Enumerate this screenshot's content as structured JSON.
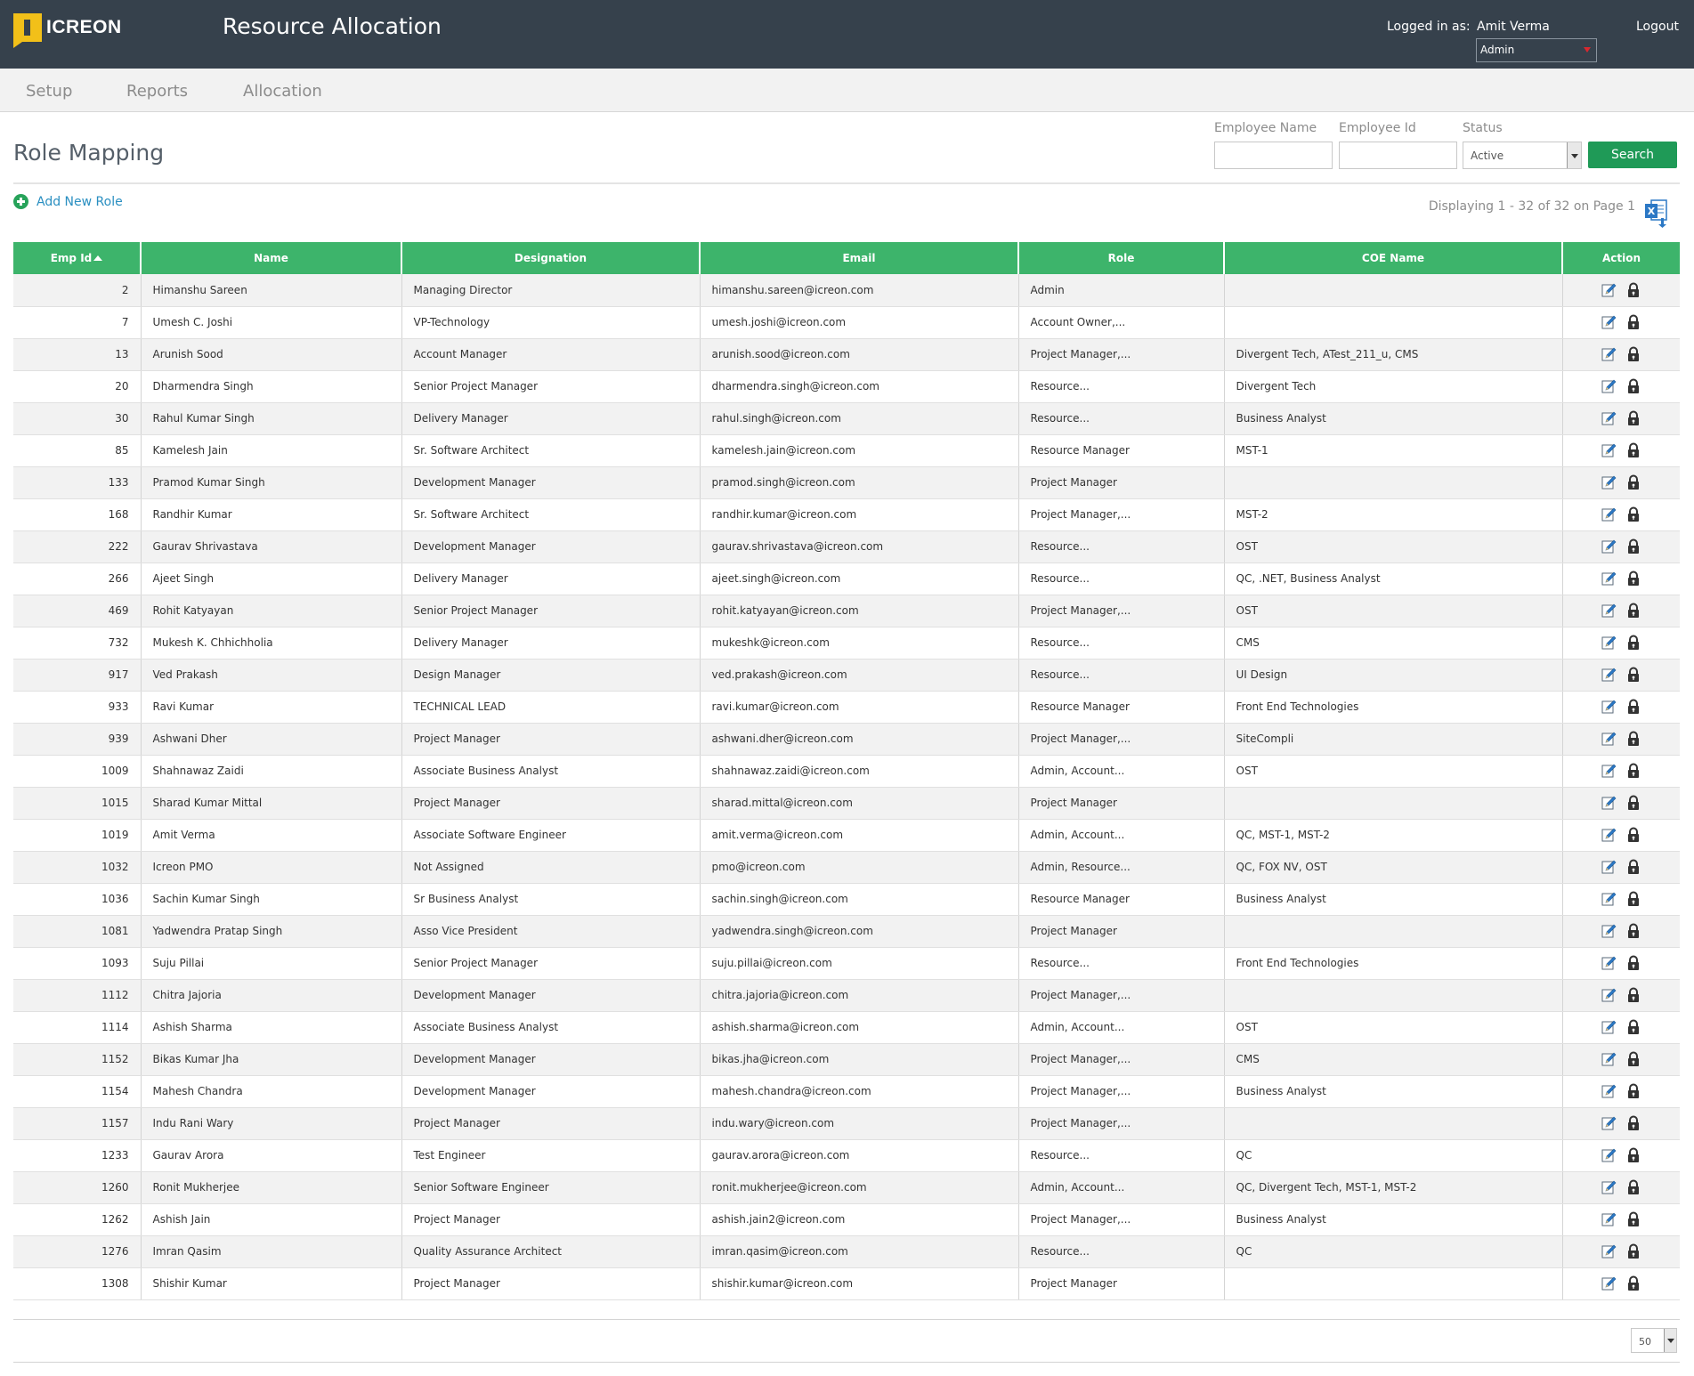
{
  "header": {
    "logo_text": "ICREON",
    "app_title": "Resource Allocation",
    "logged_in_label": "Logged in as:",
    "user_name": "Amit Verma",
    "role_selected": "Admin",
    "logout_label": "Logout"
  },
  "nav": {
    "items": [
      "Setup",
      "Reports",
      "Allocation"
    ]
  },
  "page": {
    "title": "Role Mapping"
  },
  "filters": {
    "employee_name_label": "Employee Name",
    "employee_id_label": "Employee Id",
    "status_label": "Status",
    "status_selected": "Active",
    "search_label": "Search"
  },
  "toolbar": {
    "add_new_role": "Add New Role",
    "displaying": "Displaying 1 - 32 of 32 on Page 1"
  },
  "table": {
    "columns": [
      "Emp Id",
      "Name",
      "Designation",
      "Email",
      "Role",
      "COE Name",
      "Action"
    ],
    "sorted_column": "Emp Id",
    "sort_direction": "ascending",
    "rows": [
      [
        "2",
        "Himanshu Sareen",
        "Managing Director",
        "himanshu.sareen@icreon.com",
        "Admin",
        ""
      ],
      [
        "7",
        "Umesh C. Joshi",
        "VP-Technology",
        "umesh.joshi@icreon.com",
        "Account Owner,...",
        ""
      ],
      [
        "13",
        "Arunish Sood",
        "Account Manager",
        "arunish.sood@icreon.com",
        "Project Manager,...",
        "Divergent Tech, ATest_211_u, CMS"
      ],
      [
        "20",
        "Dharmendra Singh",
        "Senior Project Manager",
        "dharmendra.singh@icreon.com",
        "Resource...",
        "Divergent Tech"
      ],
      [
        "30",
        "Rahul Kumar Singh",
        "Delivery Manager",
        "rahul.singh@icreon.com",
        "Resource...",
        "Business Analyst"
      ],
      [
        "85",
        "Kamelesh Jain",
        "Sr. Software Architect",
        "kamelesh.jain@icreon.com",
        "Resource Manager",
        "MST-1"
      ],
      [
        "133",
        "Pramod Kumar Singh",
        "Development Manager",
        "pramod.singh@icreon.com",
        "Project Manager",
        ""
      ],
      [
        "168",
        "Randhir Kumar",
        "Sr. Software Architect",
        "randhir.kumar@icreon.com",
        "Project Manager,...",
        "MST-2"
      ],
      [
        "222",
        "Gaurav Shrivastava",
        "Development Manager",
        "gaurav.shrivastava@icreon.com",
        "Resource...",
        "OST"
      ],
      [
        "266",
        "Ajeet Singh",
        "Delivery Manager",
        "ajeet.singh@icreon.com",
        "Resource...",
        "QC, .NET, Business Analyst"
      ],
      [
        "469",
        "Rohit Katyayan",
        "Senior Project Manager",
        "rohit.katyayan@icreon.com",
        "Project Manager,...",
        "OST"
      ],
      [
        "732",
        "Mukesh K. Chhichholia",
        "Delivery Manager",
        "mukeshk@icreon.com",
        "Resource...",
        "CMS"
      ],
      [
        "917",
        "Ved Prakash",
        "Design Manager",
        "ved.prakash@icreon.com",
        "Resource...",
        "UI Design"
      ],
      [
        "933",
        "Ravi Kumar",
        "TECHNICAL LEAD",
        "ravi.kumar@icreon.com",
        "Resource Manager",
        "Front End Technologies"
      ],
      [
        "939",
        "Ashwani Dher",
        "Project Manager",
        "ashwani.dher@icreon.com",
        "Project Manager,...",
        "SiteCompli"
      ],
      [
        "1009",
        "Shahnawaz Zaidi",
        "Associate Business Analyst",
        "shahnawaz.zaidi@icreon.com",
        "Admin, Account...",
        "OST"
      ],
      [
        "1015",
        "Sharad Kumar Mittal",
        "Project Manager",
        "sharad.mittal@icreon.com",
        "Project Manager",
        ""
      ],
      [
        "1019",
        "Amit Verma",
        "Associate Software Engineer",
        "amit.verma@icreon.com",
        "Admin, Account...",
        "QC, MST-1, MST-2"
      ],
      [
        "1032",
        "Icreon PMO",
        "Not Assigned",
        "pmo@icreon.com",
        "Admin, Resource...",
        "QC, FOX NV, OST"
      ],
      [
        "1036",
        "Sachin Kumar Singh",
        "Sr Business Analyst",
        "sachin.singh@icreon.com",
        "Resource Manager",
        "Business Analyst"
      ],
      [
        "1081",
        "Yadwendra Pratap Singh",
        "Asso Vice President",
        "yadwendra.singh@icreon.com",
        "Project Manager",
        ""
      ],
      [
        "1093",
        "Suju Pillai",
        "Senior Project Manager",
        "suju.pillai@icreon.com",
        "Resource...",
        "Front End Technologies"
      ],
      [
        "1112",
        "Chitra Jajoria",
        "Development Manager",
        "chitra.jajoria@icreon.com",
        "Project Manager,...",
        ""
      ],
      [
        "1114",
        "Ashish Sharma",
        "Associate Business Analyst",
        "ashish.sharma@icreon.com",
        "Admin, Account...",
        "OST"
      ],
      [
        "1152",
        "Bikas Kumar Jha",
        "Development Manager",
        "bikas.jha@icreon.com",
        "Project Manager,...",
        "CMS"
      ],
      [
        "1154",
        "Mahesh Chandra",
        "Development Manager",
        "mahesh.chandra@icreon.com",
        "Project Manager,...",
        "Business Analyst"
      ],
      [
        "1157",
        "Indu Rani Wary",
        "Project Manager",
        "indu.wary@icreon.com",
        "Project Manager,...",
        ""
      ],
      [
        "1233",
        "Gaurav Arora",
        "Test Engineer",
        "gaurav.arora@icreon.com",
        "Resource...",
        "QC"
      ],
      [
        "1260",
        "Ronit Mukherjee",
        "Senior Software Engineer",
        "ronit.mukherjee@icreon.com",
        "Admin, Account...",
        "QC, Divergent Tech, MST-1, MST-2"
      ],
      [
        "1262",
        "Ashish Jain",
        "Project Manager",
        "ashish.jain2@icreon.com",
        "Project Manager,...",
        "Business Analyst"
      ],
      [
        "1276",
        "Imran Qasim",
        "Quality Assurance Architect",
        "imran.qasim@icreon.com",
        "Resource...",
        "QC"
      ],
      [
        "1308",
        "Shishir Kumar",
        "Project Manager",
        "shishir.kumar@icreon.com",
        "Project Manager",
        ""
      ]
    ],
    "row_action_icons": [
      "edit-icon",
      "lock-icon"
    ]
  },
  "pager": {
    "page_size": "50"
  },
  "colors": {
    "header_bg": "#36414c",
    "logo_yellow": "#f2c019",
    "table_header_green": "#3db46b",
    "search_button_green": "#1f9a57",
    "link_blue": "#2a8fc1"
  }
}
